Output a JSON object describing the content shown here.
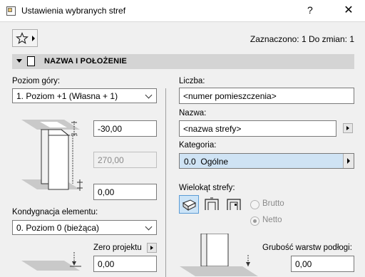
{
  "window": {
    "title": "Ustawienia wybranych stref",
    "help_label": "?",
    "close_label": "✕"
  },
  "header": {
    "selection_info": "Zaznaczono: 1 Do zmian: 1"
  },
  "section": {
    "title": "NAZWA I POŁOŻENIE"
  },
  "left": {
    "top_level_label": "Poziom góry:",
    "top_level_value": "1. Poziom +1 (Własna + 1)",
    "top_offset": "-30,00",
    "height": "270,00",
    "bottom_offset": "0,00",
    "home_story_label": "Kondygnacja elementu:",
    "home_story_value": "0. Poziom 0 (bieżąca)",
    "reference_label": "Zero projektu",
    "reference_value": "0,00"
  },
  "right": {
    "number_label": "Liczba:",
    "number_value": "<numer pomieszczenia>",
    "name_label": "Nazwa:",
    "name_value": "<nazwa strefy>",
    "category_label": "Kategoria:",
    "category_code": "0.0",
    "category_name": "Ogólne",
    "polygon_label": "Wielokąt strefy:",
    "gross_label": "Brutto",
    "net_label": "Netto",
    "floor_thickness_label": "Grubość warstw podłogi:",
    "floor_thickness_value": "0,00"
  },
  "colors": {
    "section_bar": "#d4d4d4",
    "category_highlight": "#cfe3f4",
    "active_button": "#cce4f7"
  }
}
